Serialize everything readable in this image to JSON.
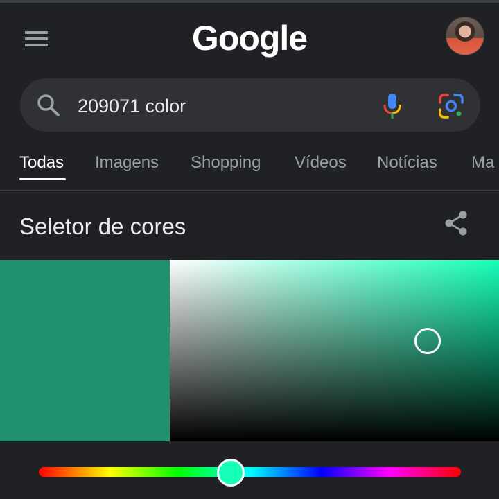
{
  "header": {
    "logo_text": "Google"
  },
  "search": {
    "query": "209071 color"
  },
  "tabs": [
    {
      "label": "Todas",
      "active": true
    },
    {
      "label": "Imagens",
      "active": false
    },
    {
      "label": "Shopping",
      "active": false
    },
    {
      "label": "Vídeos",
      "active": false
    },
    {
      "label": "Notícias",
      "active": false
    },
    {
      "label": "Ma",
      "active": false
    }
  ],
  "color_picker": {
    "title": "Seletor de cores",
    "selected_hex": "#209071",
    "hue_color": "#16ffb8",
    "hue_handle_color": "#16ffb8"
  },
  "icons": {
    "menu": "menu-icon",
    "search": "search-icon",
    "mic": "mic-icon",
    "lens": "lens-icon",
    "share": "share-icon"
  }
}
